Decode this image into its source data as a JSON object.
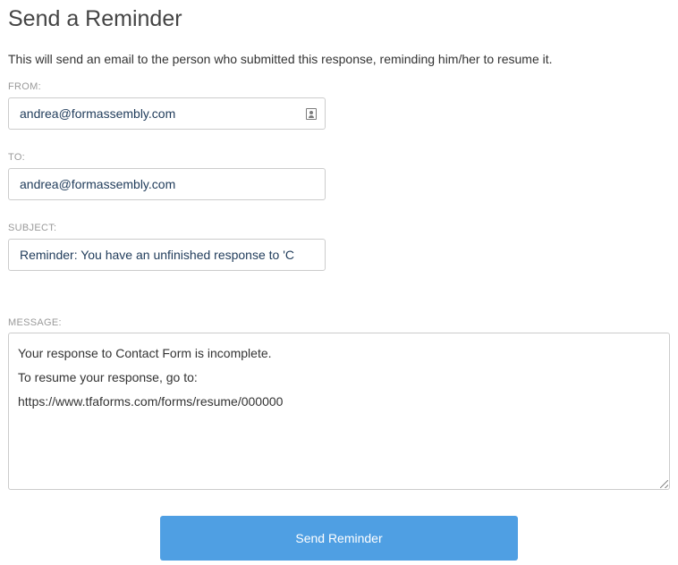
{
  "title": "Send a Reminder",
  "intro": "This will send an email to the person who submitted this response, reminding him/her to resume it.",
  "from": {
    "label": "FROM:",
    "value": "andrea@formassembly.com",
    "icon": "contact-card-icon"
  },
  "to": {
    "label": "TO:",
    "value": "andrea@formassembly.com"
  },
  "subject": {
    "label": "SUBJECT:",
    "value": "Reminder: You have an unfinished response to 'C"
  },
  "message": {
    "label": "MESSAGE:",
    "lines": [
      "Your response to Contact Form is incomplete.",
      "To resume your response, go to:",
      "https://www.tfaforms.com/forms/resume/000000"
    ]
  },
  "send_button": {
    "label": "Send Reminder",
    "color": "#4f9fe3"
  }
}
